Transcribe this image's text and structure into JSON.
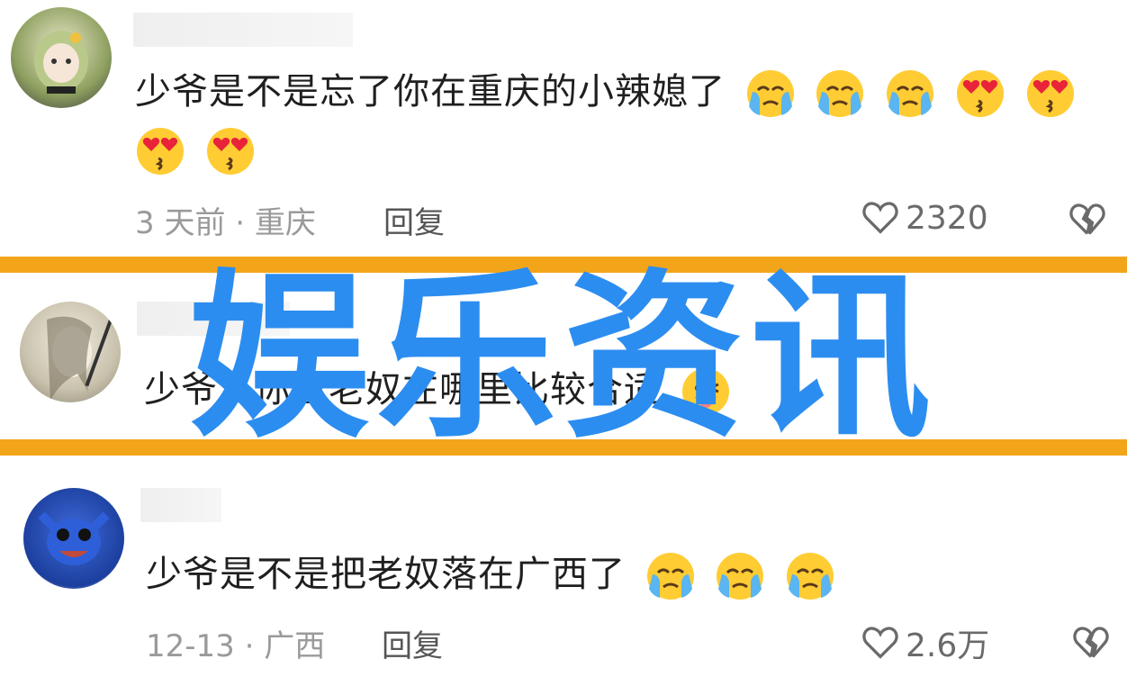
{
  "comments": [
    {
      "text": "少爷是不是忘了你在重庆的小辣媳了",
      "meta": "3 天前 · 重庆",
      "reply": "回复",
      "likes": "2320",
      "emojis": [
        "crying",
        "crying",
        "crying",
        "heart-eyes",
        "heart-eyes",
        "heart-eyes",
        "heart-eyes"
      ]
    },
    {
      "text": "少爷，你看老奴在哪里比较合适",
      "emojis": [
        "winking"
      ]
    },
    {
      "text": "少爷是不是把老奴落在广西了",
      "meta": "12-13 · 广西",
      "reply": "回复",
      "likes": "2.6万",
      "emojis": [
        "crying",
        "crying",
        "crying"
      ]
    }
  ],
  "banner": {
    "title": "娱乐资讯"
  },
  "colors": {
    "banner_text": "#2c8df0",
    "band": "#f3a51a",
    "meta": "#9a9a9a"
  }
}
